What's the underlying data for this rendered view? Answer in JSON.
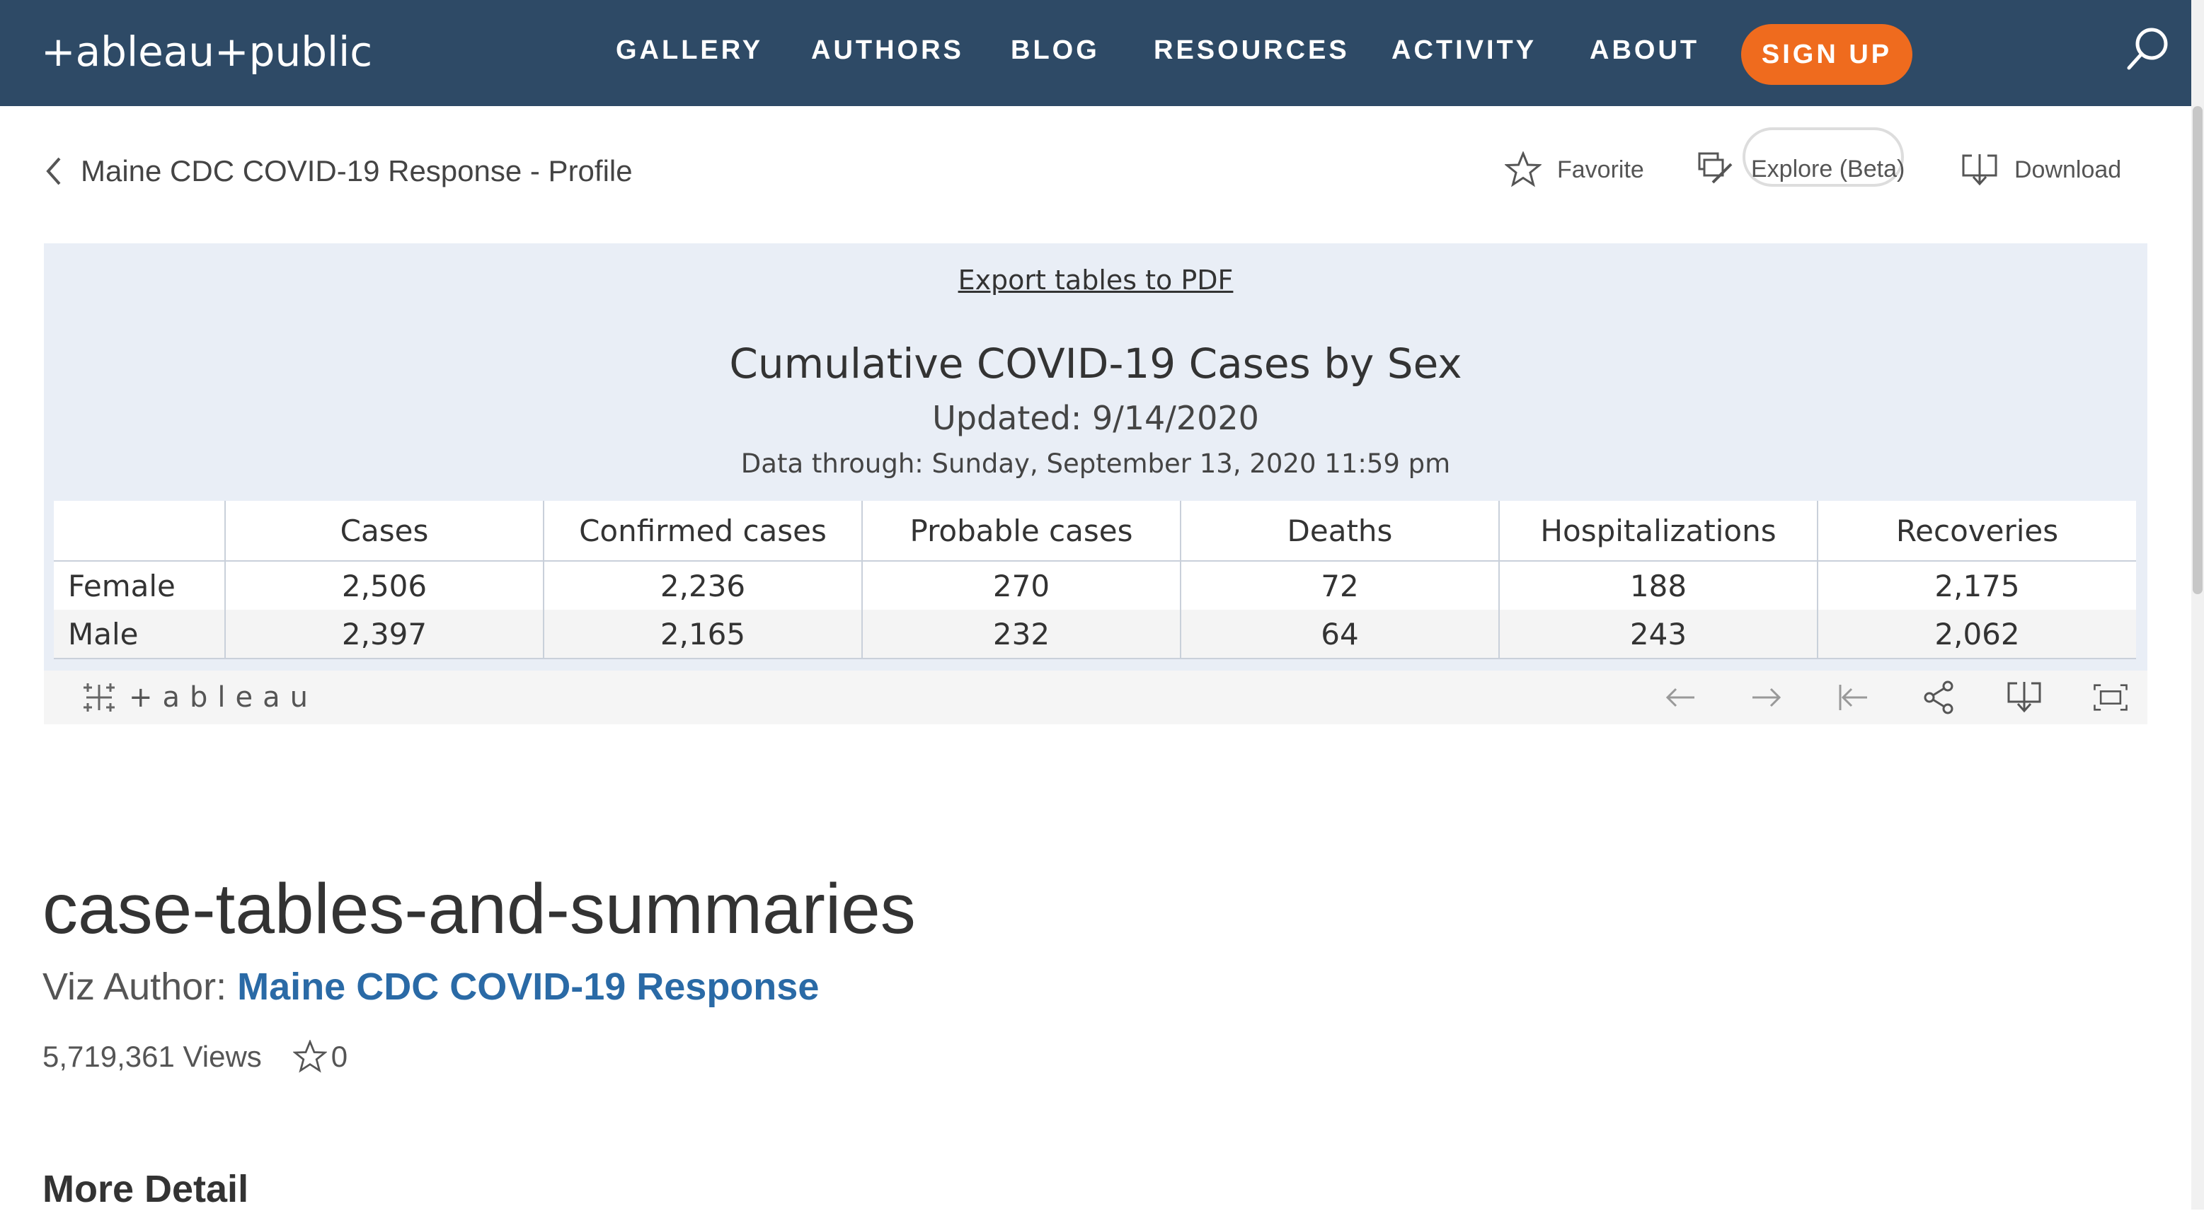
{
  "nav": {
    "logo_text": "+ableau+public",
    "items": [
      {
        "label": "GALLERY"
      },
      {
        "label": "AUTHORS"
      },
      {
        "label": "BLOG"
      },
      {
        "label": "RESOURCES"
      },
      {
        "label": "ACTIVITY"
      },
      {
        "label": "ABOUT"
      }
    ],
    "signup_label": "SIGN UP",
    "colors": {
      "bar": "#2e4a66",
      "signup": "#ef6b1e"
    }
  },
  "toolbar": {
    "back_label": "Maine CDC COVID-19 Response - Profile",
    "favorite_label": "Favorite",
    "explore_label": "Explore (Beta)",
    "download_label": "Download"
  },
  "viz": {
    "export_label": "Export tables to PDF",
    "title": "Cumulative COVID-19 Cases by Sex",
    "updated": "Updated: 9/14/2020",
    "data_through": "Data through: Sunday, September 13, 2020 11:59 pm",
    "table": {
      "columns": [
        "",
        "Cases",
        "Confirmed cases",
        "Probable cases",
        "Deaths",
        "Hospitalizations",
        "Recoveries"
      ],
      "rows": [
        {
          "label": "Female",
          "values": [
            "2,506",
            "2,236",
            "270",
            "72",
            "188",
            "2,175"
          ]
        },
        {
          "label": "Male",
          "values": [
            "2,397",
            "2,165",
            "232",
            "64",
            "243",
            "2,062"
          ]
        }
      ]
    },
    "footer_brand": "+ableau",
    "background": "#e9eef6"
  },
  "page": {
    "title": "case-tables-and-summaries",
    "author_prefix": "Viz Author: ",
    "author_name": "Maine CDC COVID-19 Response",
    "views": "5,719,361 Views",
    "favorites": "0",
    "more_detail": "More Detail",
    "link_color": "#2a6aa6"
  }
}
